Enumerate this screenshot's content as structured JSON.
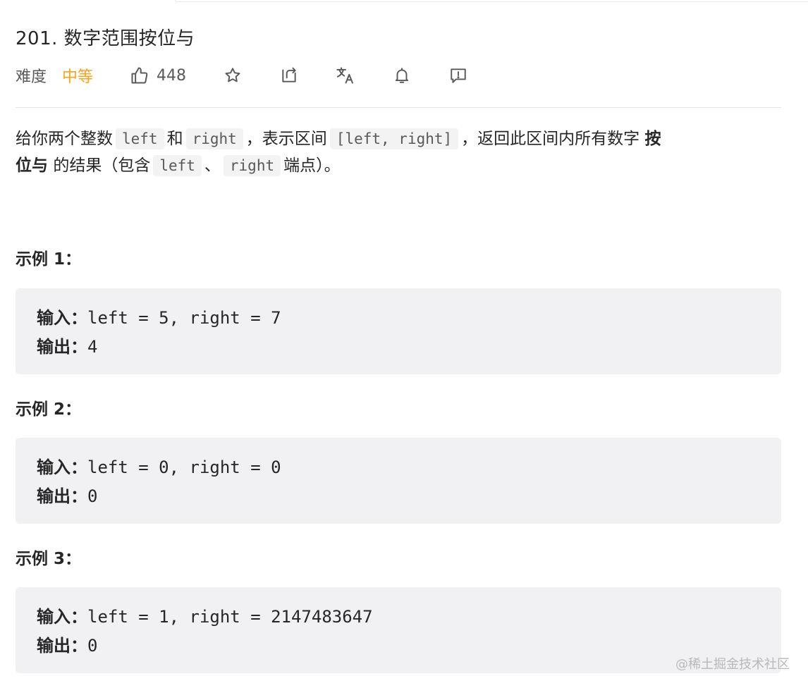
{
  "problem": {
    "title": "201. 数字范围按位与",
    "difficulty_label": "难度",
    "difficulty_value": "中等",
    "likes": "448"
  },
  "toolbar": {
    "icons": [
      "thumbs-up-icon",
      "star-icon",
      "share-icon",
      "translate-icon",
      "bell-icon",
      "feedback-icon"
    ]
  },
  "description": {
    "t1": "给你两个整数",
    "c1": "left",
    "t2": "和",
    "c2": "right",
    "t3": "，表示区间",
    "c3": "[left, right]",
    "t4": "，返回此区间内所有数字",
    "b1": "按",
    "b2": "位与",
    "t5": "的结果（包含",
    "c4": "left",
    "t6": "、",
    "c5": "right",
    "t7": "端点）。"
  },
  "examples": [
    {
      "title": "示例 1：",
      "input_label": "输入：",
      "input": "left = 5, right = 7",
      "output_label": "输出：",
      "output": "4"
    },
    {
      "title": "示例 2：",
      "input_label": "输入：",
      "input": "left = 0, right = 0",
      "output_label": "输出：",
      "output": "0"
    },
    {
      "title": "示例 3：",
      "input_label": "输入：",
      "input": "left = 1, right = 2147483647",
      "output_label": "输出：",
      "output": "0"
    }
  ],
  "watermark": "@稀土掘金技术社区"
}
